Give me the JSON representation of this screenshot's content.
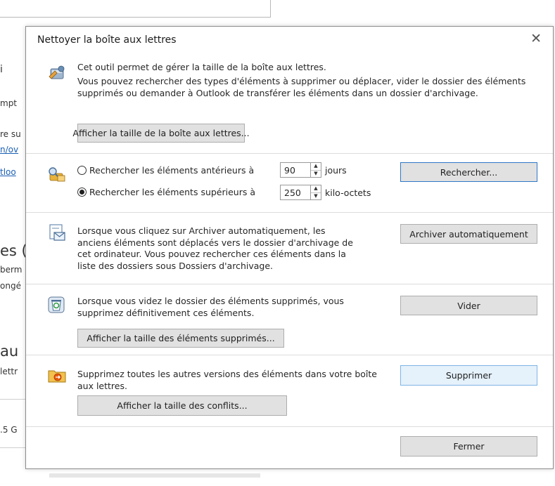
{
  "background": {
    "fragments": [
      "i",
      "mpt",
      "re su",
      "n/ov",
      "tloo",
      "es (",
      "berm",
      "ongé",
      "au",
      "lettr",
      ".5 G"
    ]
  },
  "dialog": {
    "title": "Nettoyer la boîte aux lettres",
    "close_symbol": "✕",
    "mailbox": {
      "line1": "Cet outil permet de gérer la taille de la boîte aux lettres.",
      "line2": "Vous pouvez rechercher des types d'éléments à supprimer ou déplacer, vider le dossier des éléments supprimés ou demander à Outlook de transférer les éléments dans un dossier d'archivage.",
      "size_button": "Afficher la taille de la boîte aux lettres..."
    },
    "search": {
      "older_label": "Rechercher les éléments antérieurs à",
      "older_value": "90",
      "older_unit": "jours",
      "larger_label": "Rechercher les éléments supérieurs à",
      "larger_value": "250",
      "larger_unit": "kilo-octets",
      "selected": "larger",
      "search_button": "Rechercher..."
    },
    "archive": {
      "text": "Lorsque vous cliquez sur Archiver automatiquement, les anciens éléments sont déplacés vers le dossier d'archivage de cet ordinateur. Vous pouvez rechercher ces éléments dans la liste des dossiers sous Dossiers d'archivage.",
      "button": "Archiver automatiquement"
    },
    "deleted": {
      "text": "Lorsque vous videz le dossier des éléments supprimés, vous supprimez définitivement ces éléments.",
      "empty_button": "Vider",
      "size_button": "Afficher la taille des éléments supprimés..."
    },
    "conflicts": {
      "text": "Supprimez toutes les autres versions des éléments dans votre boîte aux lettres.",
      "delete_button": "Supprimer",
      "size_button": "Afficher la taille des conflits..."
    },
    "close_button": "Fermer"
  },
  "icons": {
    "mailbox": "mailbox-tool-icon",
    "search": "search-items-icon",
    "archive": "auto-archive-icon",
    "deleted": "recycle-bin-icon",
    "conflicts": "conflicts-folder-icon"
  }
}
